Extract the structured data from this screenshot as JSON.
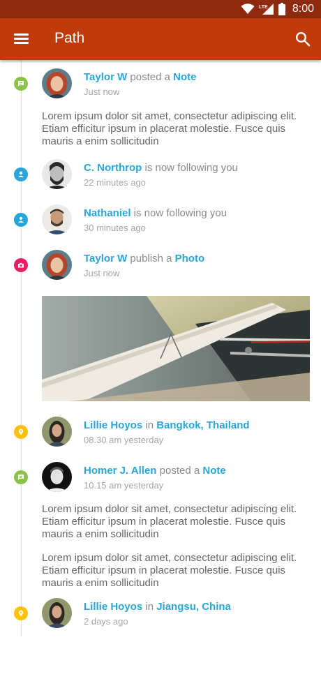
{
  "status_bar": {
    "time": "8:00",
    "network": "LTE"
  },
  "app_bar": {
    "title": "Path"
  },
  "colors": {
    "accent": "#29a6d9",
    "app_bar": "#c13a0b",
    "status_bar": "#8e2a0d",
    "note_dot": "#8bc34a",
    "follow_dot": "#29a6d9",
    "photo_dot": "#e91e63",
    "location_dot": "#ffc107"
  },
  "feed": [
    {
      "type": "note",
      "icon": "note-icon",
      "user": "Taylor W",
      "action": " posted a ",
      "target": "Note",
      "time": "Just now",
      "text": "Lorem ipsum dolor sit amet, consectetur adipiscing elit. Etiam efficitur ipsum in placerat molestie.  Fusce quis mauris a enim sollicitudin"
    },
    {
      "type": "follow",
      "icon": "person-icon",
      "user": "C. Northrop",
      "action": " is now following you",
      "time": "22 minutes ago"
    },
    {
      "type": "follow",
      "icon": "person-icon",
      "user": "Nathaniel",
      "action": " is now following you",
      "time": "30 minutes ago"
    },
    {
      "type": "photo",
      "icon": "camera-icon",
      "user": "Taylor W",
      "action": " publish a ",
      "target": "Photo",
      "time": "Just now"
    },
    {
      "type": "location",
      "icon": "location-pin-icon",
      "user": "Lillie Hoyos",
      "action": " in ",
      "target": "Bangkok, Thailand",
      "time": "08.30 am yesterday"
    },
    {
      "type": "note",
      "icon": "note-icon",
      "user": "Homer J. Allen",
      "action": " posted a ",
      "target": "Note",
      "time": "10.15 am yesterday",
      "text": "Lorem ipsum dolor sit amet, consectetur adipiscing elit. Etiam efficitur ipsum in placerat molestie.  Fusce quis mauris a enim sollicitudin",
      "text2": "Lorem ipsum dolor sit amet, consectetur adipiscing elit. Etiam efficitur ipsum in placerat molestie.  Fusce quis mauris a enim sollicitudin"
    },
    {
      "type": "location",
      "icon": "location-pin-icon",
      "user": "Lillie Hoyos",
      "action": " in ",
      "target": "Jiangsu, China",
      "time": "2 days ago"
    }
  ]
}
